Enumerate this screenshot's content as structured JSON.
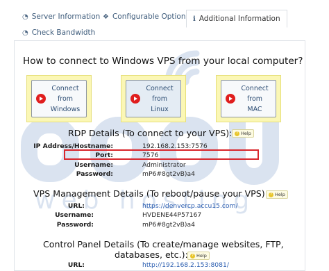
{
  "tabs": [
    {
      "label": "Server Information",
      "icon": "dashboard-icon"
    },
    {
      "label": "Configurable Options",
      "icon": "cubes-icon"
    },
    {
      "label": "Additional Information",
      "icon": "info-icon"
    },
    {
      "label": "Check Bandwidth",
      "icon": "dashboard-icon"
    }
  ],
  "heading": "How to connect to Windows VPS from your local computer?",
  "connect_buttons": [
    {
      "line1": "Connect from",
      "line2": "Windows"
    },
    {
      "line1": "Connect from",
      "line2": "Linux"
    },
    {
      "line1": "Connect from",
      "line2": "MAC"
    }
  ],
  "help_label": "Help",
  "rdp": {
    "title": "RDP Details (To connect to your VPS):",
    "rows": [
      {
        "label": "IP Address/Hostname:",
        "value": "192.168.2.153:7576"
      },
      {
        "label": "Port:",
        "value": "7576"
      },
      {
        "label": "Username:",
        "value": "Administrator"
      },
      {
        "label": "Password:",
        "value": "mP6#8gt2vB)a4"
      }
    ]
  },
  "vps": {
    "title": "VPS Management Details (To reboot/pause your VPS):",
    "rows": [
      {
        "label": "URL:",
        "value": "https://denvercp.accu15.com/"
      },
      {
        "label": "Username:",
        "value": "HVDENE44P57167"
      },
      {
        "label": "Password:",
        "value": "mP6#8gt2vB)a4"
      }
    ]
  },
  "cp": {
    "title_line1": "Control Panel Details (To create/manage websites, FTP,",
    "title_line2": "databases, etc.):",
    "rows": [
      {
        "label": "URL:",
        "value": "http://192.168.2.153:8081/"
      }
    ]
  },
  "watermark": {
    "logo": "accu",
    "tagline": "web hosting"
  },
  "colors": {
    "accent": "#3c5a7a",
    "link": "#2a5db0",
    "highlight": "#d9262c",
    "box": "#fbf7b5"
  }
}
